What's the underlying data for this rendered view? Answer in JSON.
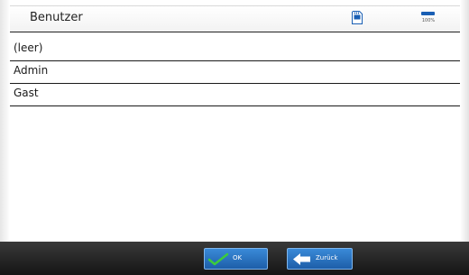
{
  "header": {
    "title": "Benutzer",
    "icons": {
      "sd_card": "sd-card-icon",
      "battery": "battery-icon"
    },
    "battery_label": "100%"
  },
  "users": {
    "items": [
      {
        "label": "(leer)"
      },
      {
        "label": "Admin"
      },
      {
        "label": "Gast"
      }
    ]
  },
  "footer": {
    "ok_label": "OK",
    "back_label": "Zurück",
    "icons": {
      "ok": "checkmark-icon",
      "back": "arrow-left-icon"
    }
  },
  "colors": {
    "accent": "#1d5ea8",
    "checkmark": "#3ccc3c",
    "bottom_bar": "#1e1e1e"
  }
}
